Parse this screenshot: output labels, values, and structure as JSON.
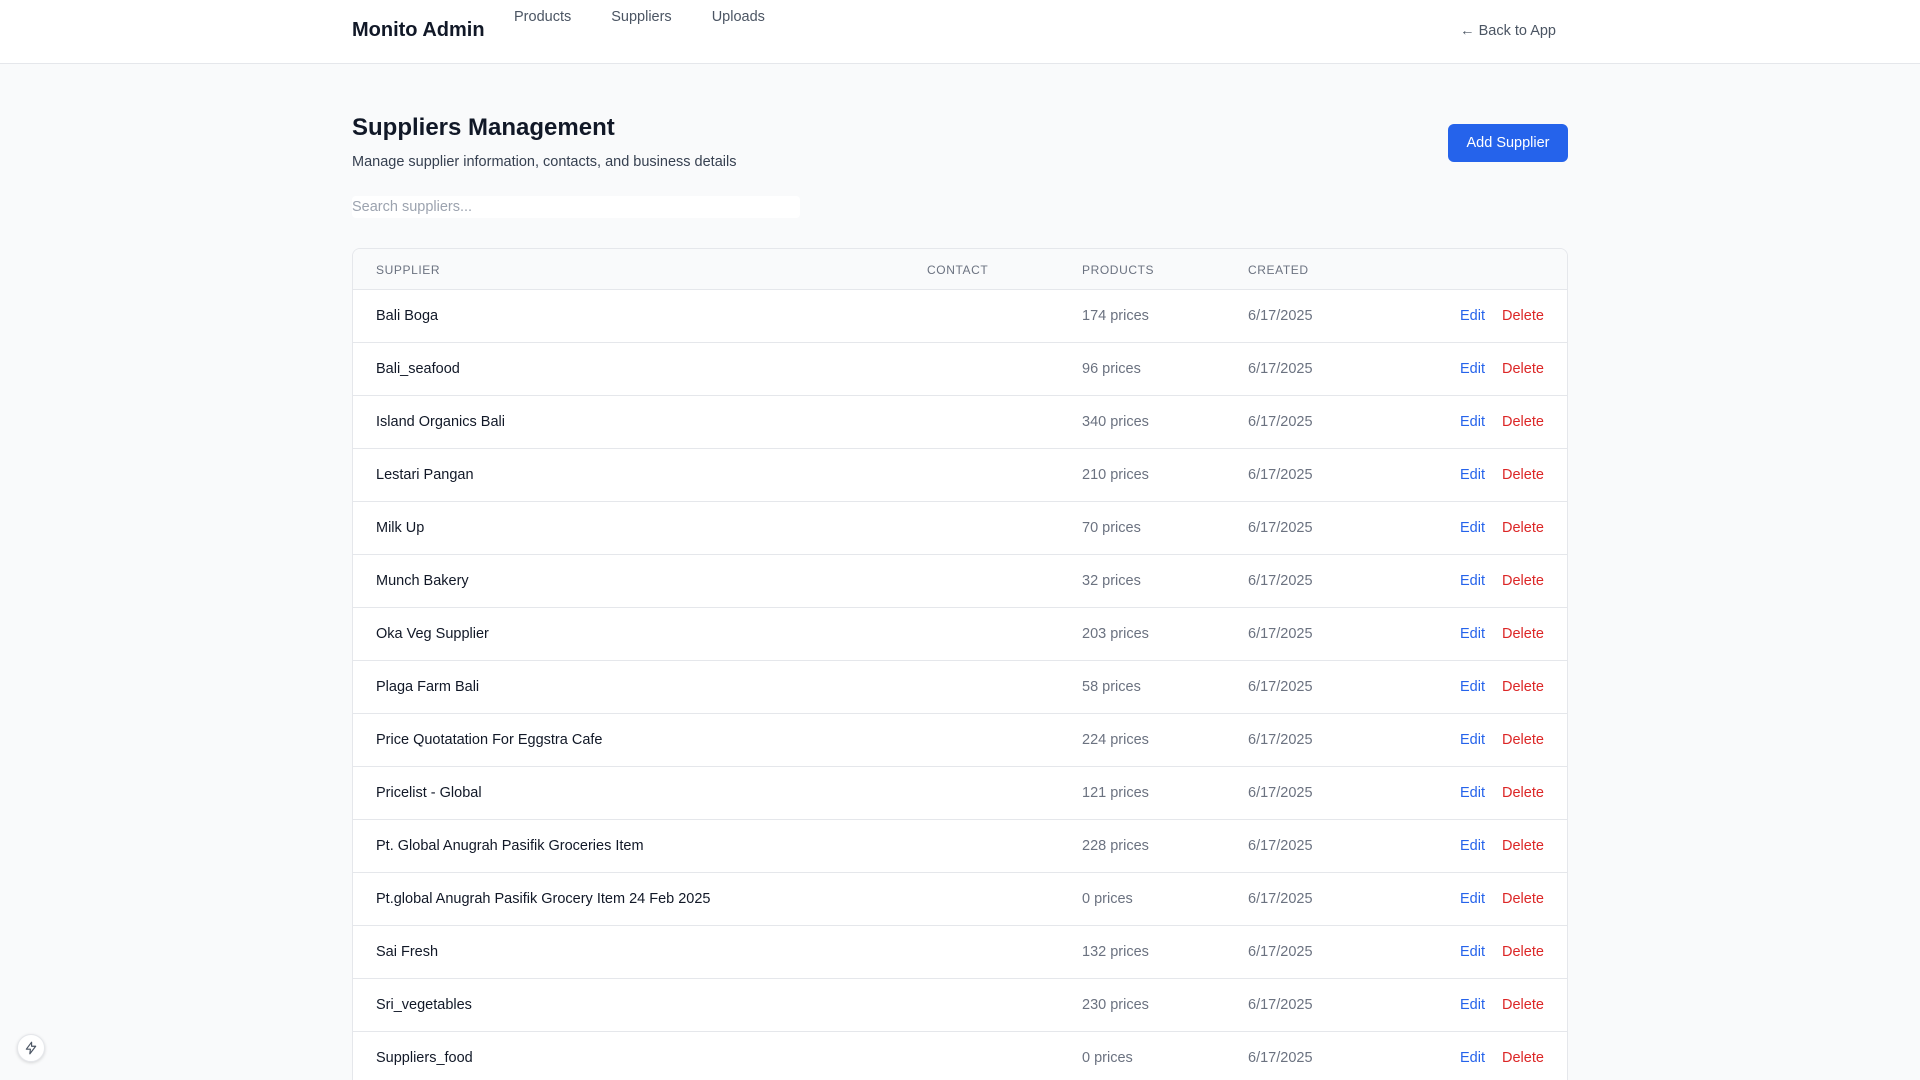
{
  "header": {
    "brand": "Monito Admin",
    "nav": [
      "Products",
      "Suppliers",
      "Uploads"
    ],
    "back_label": "← Back to App"
  },
  "page": {
    "title": "Suppliers Management",
    "subtitle": "Manage supplier information, contacts, and business details",
    "add_button": "Add Supplier",
    "search_placeholder": "Search suppliers..."
  },
  "table": {
    "headers": {
      "supplier": "Supplier",
      "contact": "Contact",
      "products": "Products",
      "created": "Created"
    },
    "edit_label": "Edit",
    "delete_label": "Delete",
    "rows": [
      {
        "name": "Bali Boga",
        "contact": "",
        "products": "174 prices",
        "created": "6/17/2025"
      },
      {
        "name": "Bali_seafood",
        "contact": "",
        "products": "96 prices",
        "created": "6/17/2025"
      },
      {
        "name": "Island Organics Bali",
        "contact": "",
        "products": "340 prices",
        "created": "6/17/2025"
      },
      {
        "name": "Lestari Pangan",
        "contact": "",
        "products": "210 prices",
        "created": "6/17/2025"
      },
      {
        "name": "Milk Up",
        "contact": "",
        "products": "70 prices",
        "created": "6/17/2025"
      },
      {
        "name": "Munch Bakery",
        "contact": "",
        "products": "32 prices",
        "created": "6/17/2025"
      },
      {
        "name": "Oka Veg Supplier",
        "contact": "",
        "products": "203 prices",
        "created": "6/17/2025"
      },
      {
        "name": "Plaga Farm Bali",
        "contact": "",
        "products": "58 prices",
        "created": "6/17/2025"
      },
      {
        "name": "Price Quotatation For Eggstra Cafe",
        "contact": "",
        "products": "224 prices",
        "created": "6/17/2025"
      },
      {
        "name": "Pricelist - Global",
        "contact": "",
        "products": "121 prices",
        "created": "6/17/2025"
      },
      {
        "name": "Pt. Global Anugrah Pasifik Groceries Item",
        "contact": "",
        "products": "228 prices",
        "created": "6/17/2025"
      },
      {
        "name": "Pt.global Anugrah Pasifik Grocery Item 24 Feb 2025",
        "contact": "",
        "products": "0 prices",
        "created": "6/17/2025"
      },
      {
        "name": "Sai Fresh",
        "contact": "",
        "products": "132 prices",
        "created": "6/17/2025"
      },
      {
        "name": "Sri_vegetables",
        "contact": "",
        "products": "230 prices",
        "created": "6/17/2025"
      },
      {
        "name": "Suppliers_food",
        "contact": "",
        "products": "0 prices",
        "created": "6/17/2025"
      }
    ]
  },
  "icons": {
    "fab": "lightning-bolt-icon"
  },
  "colors": {
    "accent": "#2563eb",
    "danger": "#dc2626"
  }
}
